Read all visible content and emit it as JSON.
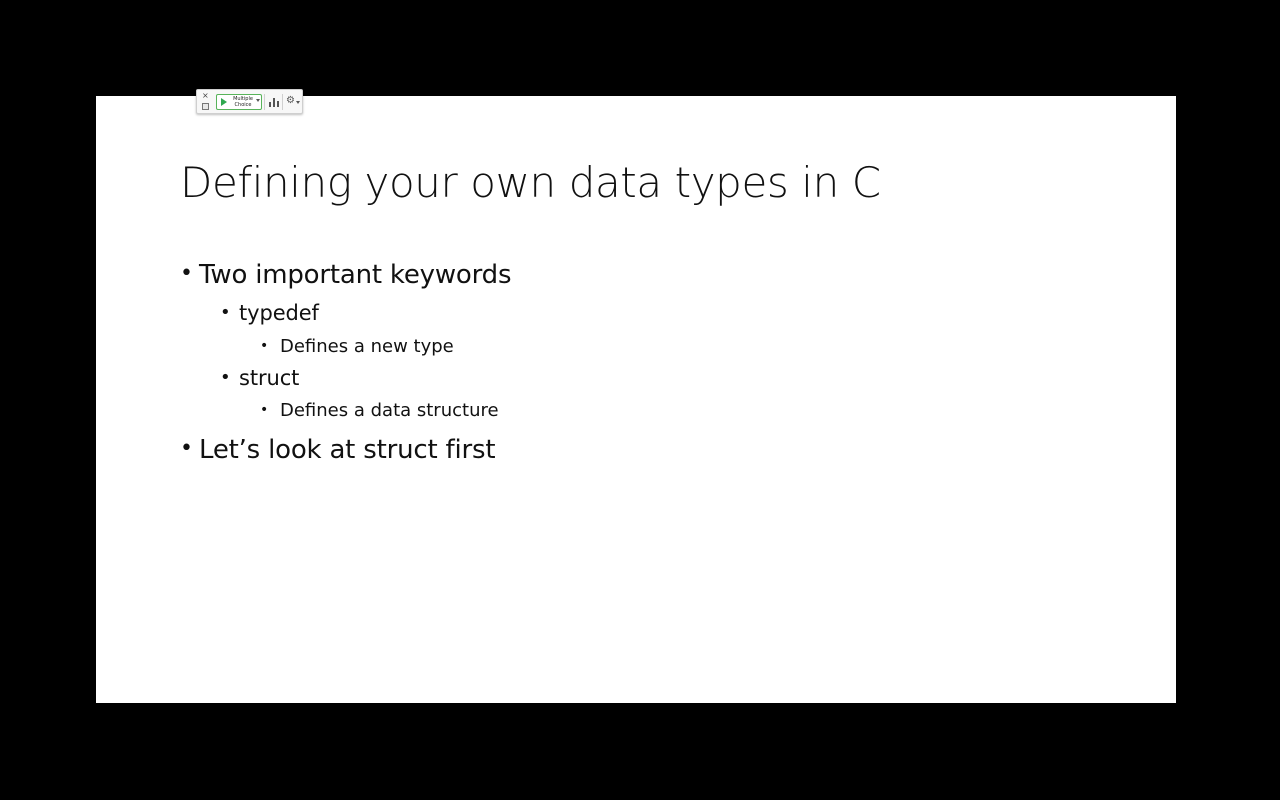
{
  "slide": {
    "title": "Defining your own data types in C",
    "bullets": [
      {
        "level": 1,
        "text": "Two important keywords"
      },
      {
        "level": 2,
        "text": "typedef"
      },
      {
        "level": 3,
        "text": "Defines a new type"
      },
      {
        "level": 2,
        "text": "struct"
      },
      {
        "level": 3,
        "text": "Defines a data structure"
      },
      {
        "level": 1,
        "text": "Let’s look at struct first"
      }
    ],
    "bullet_glyph": "•"
  },
  "toolbar": {
    "close_glyph": "×",
    "mode_label_line1": "Multiple",
    "mode_label_line2": "Choice",
    "gear_glyph": "⚙",
    "icons": [
      "close-icon",
      "minimize-icon",
      "play-icon",
      "chevron-down-icon",
      "bar-chart-icon",
      "gear-icon"
    ]
  },
  "colors": {
    "background": "#000000",
    "slide": "#ffffff",
    "text": "#111111",
    "start_accent": "#2fa84f"
  }
}
